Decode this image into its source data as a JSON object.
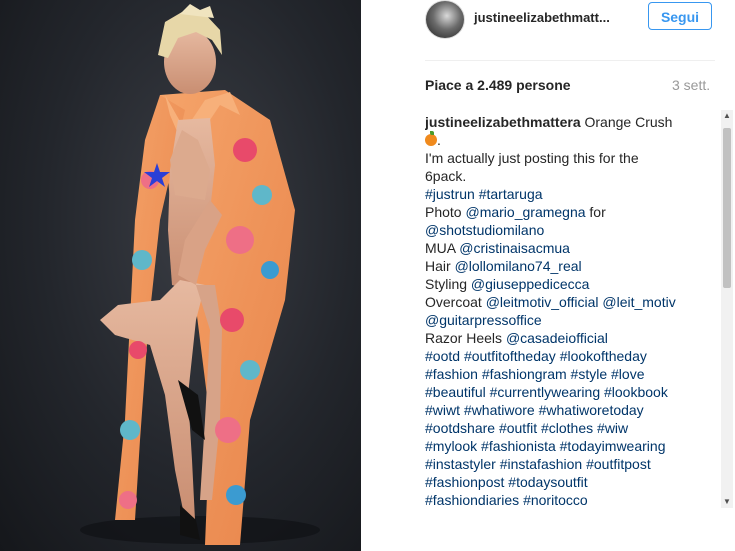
{
  "post": {
    "username": "justineelizabethmatt...",
    "follow_label": "Segui",
    "likes": "Piace a 2.489 persone",
    "time": "3 sett.",
    "caption": {
      "author": "justineelizabethmattera",
      "title": "Orange Crush",
      "lines": [
        "I'm actually just posting this for the",
        "6pack.",
        "#justrun #tartaruga",
        "Photo @mario_gramegna for",
        "@shotstudiomilano",
        "MUA @cristinaisacmua",
        "Hair @lollomilano74_real",
        "Styling @giuseppedicecca",
        "Overcoat @leitmotiv_official @leit_motiv",
        "@guitarpressoffice",
        "Razor Heels @casadeiofficial",
        "#ootd #outfitoftheday #lookoftheday",
        "#fashion #fashiongram #style #love",
        "#beautiful #currentlywearing #lookbook",
        "#wiwt #whatiwore #whatiworetoday",
        "#ootdshare #outfit #clothes #wiw",
        "#mylook #fashionista #todayimwearing",
        "#instastyler #instafashion #outfitpost",
        "#fashionpost #todaysoutfit",
        "#fashiondiaries #noritocco"
      ]
    }
  },
  "icons": {
    "orange": "tangerine-emoji-icon",
    "scroll_up": "scroll-up-arrow-icon",
    "scroll_down": "scroll-down-arrow-icon"
  },
  "colors": {
    "follow_blue": "#3897f0",
    "hashtag": "#003569",
    "coat_orange": "#f39a5e"
  }
}
